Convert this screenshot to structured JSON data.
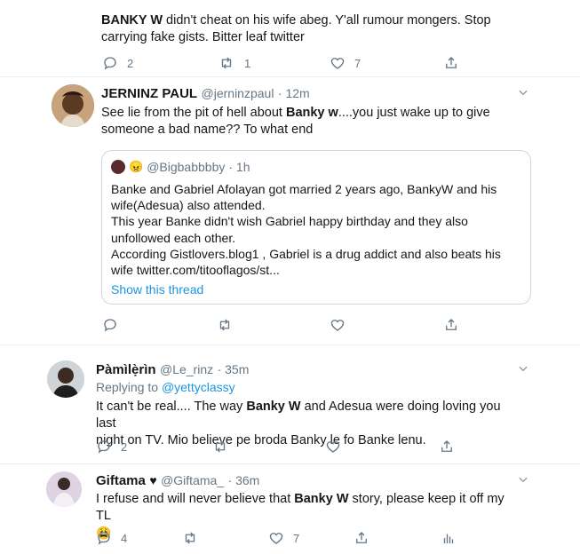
{
  "tweet1": {
    "text_bold": "BANKY W",
    "text_rest": " didn't cheat on his wife abeg. Y'all rumour mongers. Stop carrying fake gists. Bitter leaf twitter",
    "replies": "2",
    "retweets": "1",
    "likes": "7"
  },
  "tweet2": {
    "name": "JERNINZ PAUL",
    "handle": "@jerninzpaul",
    "time": "· 12m",
    "text_a": "See lie from the pit of hell about ",
    "text_bold": "Banky w",
    "text_b": "....you just wake up to give someone a bad name?? To what end",
    "quote": {
      "emoji": "😠",
      "handle": "@Bigbabbbby",
      "time": "· 1h",
      "lines": [
        "Banke and Gabriel Afolayan got married 2 years ago, BankyW and his",
        "wife(Adesua) also attended.",
        "This year Banke didn't wish Gabriel happy birthday and they also",
        "unfollowed each other.",
        "According Gistlovers.blog1 , Gabriel is a drug addict and also beats his",
        "wife twitter.com/titooflagos/st..."
      ],
      "show_thread": "Show this thread"
    }
  },
  "tweet3": {
    "name": "Pàmìlẹ̀rìn",
    "handle": "@Le_rinz",
    "time": "· 35m",
    "replying_label": "Replying to ",
    "replying_handle": "@yettyclassy",
    "text_a": "It can't be real.... The way ",
    "text_bold": "Banky W",
    "text_b1": " and Adesua were doing loving you last",
    "text_b2": "night on TV. Mio believe pe broda Banky le fo Banke lenu.",
    "replies": "2"
  },
  "tweet4": {
    "name": "Giftama",
    "heart": "♥",
    "handle": "@Giftama_",
    "time": "· 36m",
    "text_a": "I refuse and will never believe that ",
    "text_bold": "Banky W",
    "text_b": " story, please keep it off my TL",
    "emoji": "😩",
    "replies": "4",
    "likes": "7"
  },
  "colors": {
    "icon": "#657786",
    "link": "#1b95e0",
    "divider": "#e6ecf0"
  }
}
